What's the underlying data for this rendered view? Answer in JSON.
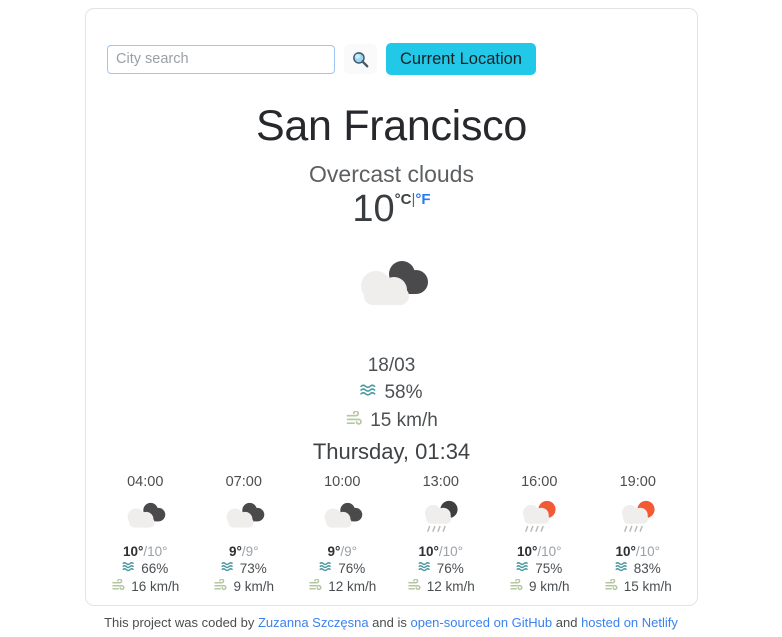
{
  "search": {
    "placeholder": "City search",
    "value": "",
    "search_icon": "magnifier-icon",
    "current_location_label": "Current Location"
  },
  "current": {
    "city": "San Francisco",
    "description": "Overcast clouds",
    "temperature": "10",
    "unit_celsius": "°C",
    "unit_separator": "|",
    "unit_fahrenheit": "°F",
    "icon": "overcast-clouds-icon",
    "date": "18/03",
    "humidity": "58%",
    "wind": "15 km/h",
    "day_time": "Thursday, 01:34",
    "humidity_icon": "humidity-waves-icon",
    "wind_icon": "wind-icon"
  },
  "forecast": [
    {
      "time": "04:00",
      "icon": "overcast-clouds-icon",
      "temp_max": "10°",
      "temp_sep": "/",
      "temp_min": "10°",
      "humidity": "66%",
      "wind": "16 km/h"
    },
    {
      "time": "07:00",
      "icon": "overcast-clouds-icon",
      "temp_max": "9°",
      "temp_sep": "/",
      "temp_min": "9°",
      "humidity": "73%",
      "wind": "9 km/h"
    },
    {
      "time": "10:00",
      "icon": "overcast-clouds-icon",
      "temp_max": "9°",
      "temp_sep": "/",
      "temp_min": "9°",
      "humidity": "76%",
      "wind": "12 km/h"
    },
    {
      "time": "13:00",
      "icon": "rain-dark-icon",
      "temp_max": "10°",
      "temp_sep": "/",
      "temp_min": "10°",
      "humidity": "76%",
      "wind": "12 km/h"
    },
    {
      "time": "16:00",
      "icon": "rain-sun-icon",
      "temp_max": "10°",
      "temp_sep": "/",
      "temp_min": "10°",
      "humidity": "75%",
      "wind": "9 km/h"
    },
    {
      "time": "19:00",
      "icon": "rain-sun-icon",
      "temp_max": "10°",
      "temp_sep": "/",
      "temp_min": "10°",
      "humidity": "83%",
      "wind": "15 km/h"
    }
  ],
  "footer": {
    "text_1": "This project was coded by ",
    "link_author": "Zuzanna Szczęsna",
    "text_2": " and is ",
    "link_github": "open-sourced on GitHub",
    "text_3": " and ",
    "link_netlify": "hosted on Netlify"
  },
  "colors": {
    "accent_cyan": "#22c8e8",
    "link_blue": "#3b82f0",
    "unit_active_blue": "#2a7bf0",
    "humidity_teal": "#4d9aa0",
    "wind_sage": "#b4c7a0",
    "cloud_light": "#efeeec",
    "cloud_dark": "#4a4a4c",
    "sun_orange": "#f15a33"
  }
}
